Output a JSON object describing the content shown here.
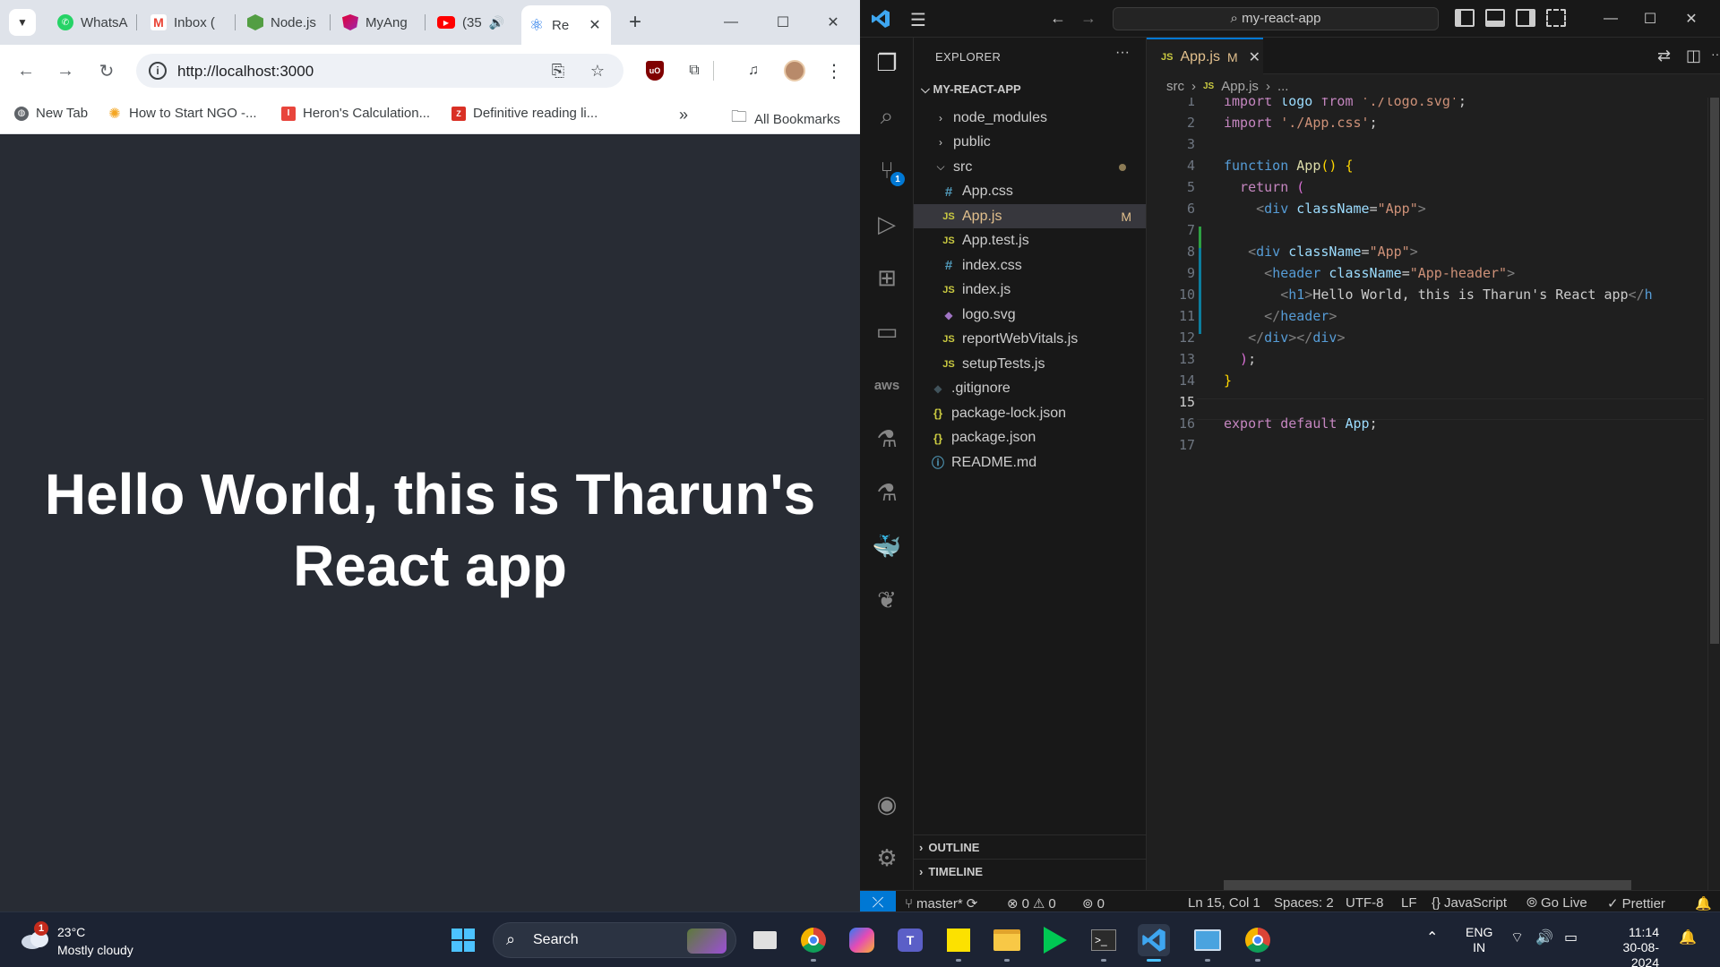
{
  "chrome": {
    "tabs": [
      {
        "label": "WhatsA",
        "icon": "whatsapp-icon"
      },
      {
        "label": "Inbox (",
        "icon": "gmail-icon"
      },
      {
        "label": "Node.js",
        "icon": "nodejs-icon"
      },
      {
        "label": "MyAng",
        "icon": "angular-icon"
      },
      {
        "label": "(35",
        "icon": "youtube-icon"
      },
      {
        "label": "Re",
        "icon": "react-icon"
      }
    ],
    "url": "http://localhost:3000",
    "bookmarks": [
      {
        "label": "New Tab"
      },
      {
        "label": "How to Start NGO -..."
      },
      {
        "label": "Heron's Calculation..."
      },
      {
        "label": "Definitive reading li..."
      }
    ],
    "all_bookmarks": "All Bookmarks",
    "page_heading": "Hello World, this is Tharun's React app"
  },
  "vscode": {
    "command_center": "my-react-app",
    "explorer_title": "EXPLORER",
    "root": "MY-REACT-APP",
    "tree": [
      {
        "name": "node_modules",
        "kind": "folder"
      },
      {
        "name": "public",
        "kind": "folder"
      },
      {
        "name": "src",
        "kind": "folder-open"
      },
      {
        "name": "App.css",
        "kind": "css"
      },
      {
        "name": "App.js",
        "kind": "js",
        "badge": "M"
      },
      {
        "name": "App.test.js",
        "kind": "js"
      },
      {
        "name": "index.css",
        "kind": "css"
      },
      {
        "name": "index.js",
        "kind": "js"
      },
      {
        "name": "logo.svg",
        "kind": "svg"
      },
      {
        "name": "reportWebVitals.js",
        "kind": "js"
      },
      {
        "name": "setupTests.js",
        "kind": "js"
      },
      {
        "name": ".gitignore",
        "kind": "git"
      },
      {
        "name": "package-lock.json",
        "kind": "json"
      },
      {
        "name": "package.json",
        "kind": "json"
      },
      {
        "name": "README.md",
        "kind": "info"
      }
    ],
    "outline": "OUTLINE",
    "timeline": "TIMELINE",
    "editor_tab": {
      "name": "App.js",
      "badge": "M"
    },
    "breadcrumb": {
      "folder": "src",
      "file": "App.js",
      "rest": "..."
    },
    "line_numbers": [
      "1",
      "2",
      "3",
      "4",
      "5",
      "6",
      "7",
      "8",
      "9",
      "10",
      "11",
      "12",
      "13",
      "14",
      "15",
      "16",
      "17"
    ],
    "code": {
      "l1": {
        "kw": "import",
        "id": " logo ",
        "kw2": "from",
        "st": " './logo.svg'",
        "p": ";"
      },
      "l2": {
        "kw": "import",
        "st": " './App.css'",
        "p": ";"
      },
      "l4": {
        "kw": "function",
        "fn": " App",
        "br": "()",
        "p": " {"
      },
      "l5": {
        "kw": "  return",
        "br": " ("
      },
      "l6": {
        "gr1": "    <",
        "tg": "div",
        "id": " className",
        "p": "=",
        "st": "\"App\"",
        "gr2": ">"
      },
      "l8": {
        "gr1": "   <",
        "tg": "div",
        "id": " className",
        "p": "=",
        "st": "\"App\"",
        "gr2": ">"
      },
      "l9": {
        "gr1": "     <",
        "tg": "header",
        "id": " className",
        "p": "=",
        "st": "\"App-header\"",
        "gr2": ">"
      },
      "l10": {
        "gr1": "       <",
        "tg": "h1",
        "gr2": ">",
        "text": "Hello World, this is Tharun's React app",
        "gr3": "</",
        "tg2": "h"
      },
      "l11": {
        "gr1": "     </",
        "tg": "header",
        "gr2": ">"
      },
      "l12": {
        "gr1": "   </",
        "tg": "div",
        "gr2": "></",
        "tg2": "div",
        "gr3": ">"
      },
      "l13": {
        "br": "  )",
        "p": ";"
      },
      "l14": {
        "p": "}"
      },
      "l16": {
        "kw": "export",
        "kw2": " default",
        "id": " App",
        "p": ";"
      }
    },
    "status": {
      "branch": "master*",
      "errors": "0",
      "warnings": "0",
      "ports": "0",
      "position": "Ln 15, Col 1",
      "spaces": "Spaces: 2",
      "encoding": "UTF-8",
      "eol": "LF",
      "language": "JavaScript",
      "golive": "Go Live",
      "prettier": "Prettier"
    },
    "scm_badge": "1"
  },
  "taskbar": {
    "weather_badge": "1",
    "temperature": "23°C",
    "weather": "Mostly cloudy",
    "search": "Search",
    "lang_top": "ENG",
    "lang_bottom": "IN",
    "time": "11:14",
    "date": "30-08-2024"
  }
}
